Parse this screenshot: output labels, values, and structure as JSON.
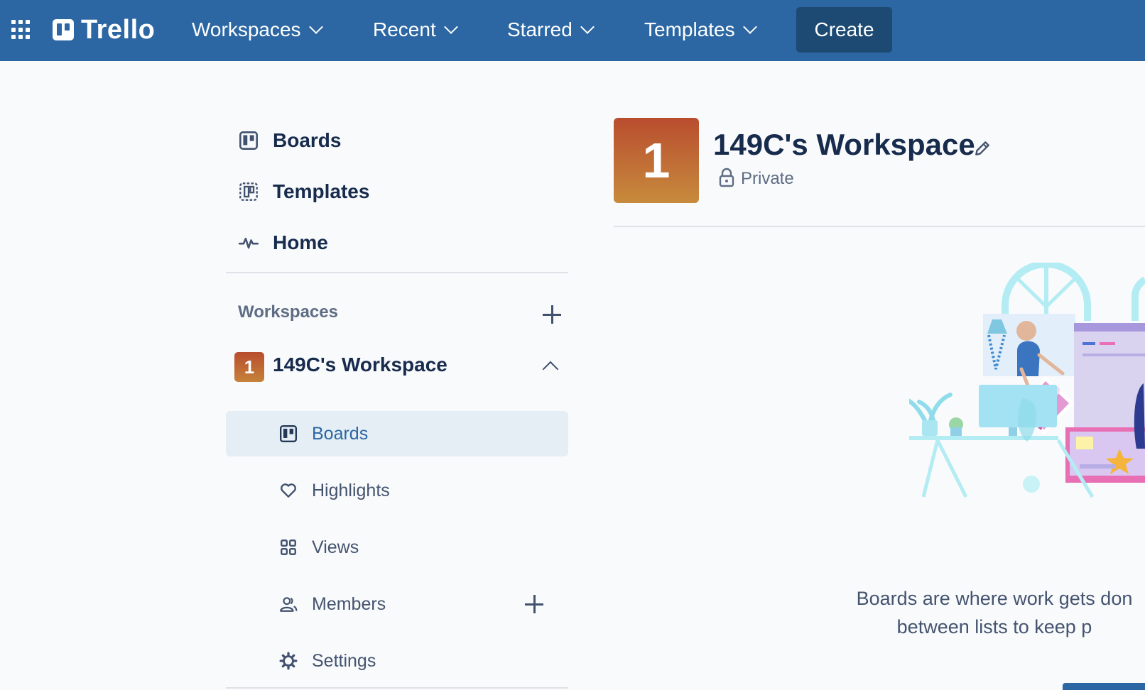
{
  "topbar": {
    "logo": "Trello",
    "nav": [
      {
        "label": "Workspaces"
      },
      {
        "label": "Recent"
      },
      {
        "label": "Starred"
      },
      {
        "label": "Templates"
      }
    ],
    "create_label": "Create",
    "background": "#2c67a3"
  },
  "sidebar": {
    "links": [
      {
        "label": "Boards",
        "icon": "board-icon"
      },
      {
        "label": "Templates",
        "icon": "template-icon"
      },
      {
        "label": "Home",
        "icon": "activity-icon"
      }
    ],
    "workspaces_header": "Workspaces",
    "workspace": {
      "badge": "1",
      "name": "149C's Workspace"
    },
    "sub_items": [
      {
        "label": "Boards",
        "icon": "board-icon",
        "active": true
      },
      {
        "label": "Highlights",
        "icon": "heart-icon"
      },
      {
        "label": "Views",
        "icon": "grid-icon"
      },
      {
        "label": "Members",
        "icon": "members-icon"
      },
      {
        "label": "Settings",
        "icon": "gear-icon"
      }
    ]
  },
  "main": {
    "badge": "1",
    "title": "149C's Workspace",
    "visibility": "Private",
    "empty_line1": "Boards are where work gets don",
    "empty_line2": "between lists to keep p"
  }
}
